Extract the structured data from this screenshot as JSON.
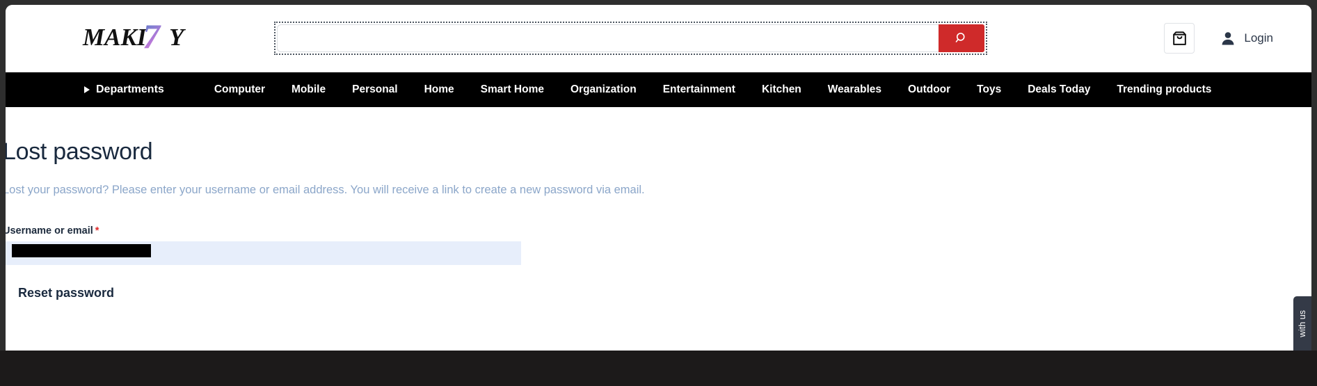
{
  "brand": {
    "logo_text": "MAKI7Y",
    "logo_part_a": "MAKI",
    "logo_part_b": "7",
    "logo_part_c": "Y",
    "accent_red": "#cf2a2a",
    "nav_background": "#000000",
    "heading_color": "#19293e",
    "description_color": "#8ba6c9",
    "input_background": "#e7eefb"
  },
  "header": {
    "search": {
      "value": "",
      "placeholder": "",
      "button_icon": "search-icon",
      "button_label": "Search"
    },
    "cart": {
      "icon": "shopping-bag-icon",
      "label": "Cart"
    },
    "account": {
      "icon": "user-icon",
      "label": "Login"
    }
  },
  "nav": {
    "departments": {
      "label": "Departments",
      "icon": "caret-right-icon"
    },
    "items": [
      {
        "label": "Computer"
      },
      {
        "label": "Mobile"
      },
      {
        "label": "Personal"
      },
      {
        "label": "Home"
      },
      {
        "label": "Smart Home"
      },
      {
        "label": "Organization"
      },
      {
        "label": "Entertainment"
      },
      {
        "label": "Kitchen"
      },
      {
        "label": "Wearables"
      },
      {
        "label": "Outdoor"
      },
      {
        "label": "Toys"
      },
      {
        "label": "Deals Today"
      },
      {
        "label": "Trending products"
      }
    ]
  },
  "main": {
    "title": "Lost password",
    "description": "Lost your password? Please enter your username or email address. You will receive a link to create a new password via email.",
    "form": {
      "username_label": "Username or email",
      "required_marker": "*",
      "username_value": "",
      "username_placeholder": "",
      "submit_label": "Reset password"
    }
  },
  "chat_widget": {
    "label": "with us"
  }
}
